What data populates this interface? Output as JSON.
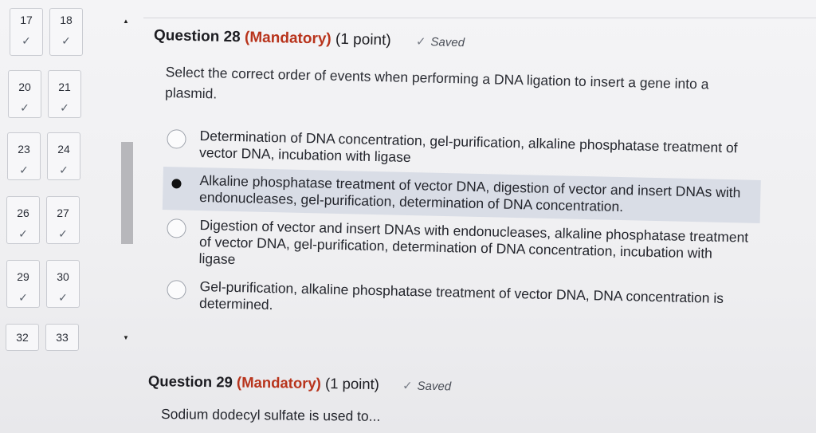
{
  "nav": {
    "cells": [
      {
        "num": "17",
        "check": "✓"
      },
      {
        "num": "18",
        "check": "✓"
      },
      {
        "num": "20",
        "check": "✓"
      },
      {
        "num": "21",
        "check": "✓"
      },
      {
        "num": "23",
        "check": "✓"
      },
      {
        "num": "24",
        "check": "✓"
      },
      {
        "num": "26",
        "check": "✓"
      },
      {
        "num": "27",
        "check": "✓"
      },
      {
        "num": "29",
        "check": "✓"
      },
      {
        "num": "30",
        "check": "✓"
      },
      {
        "num": "32",
        "check": ""
      },
      {
        "num": "33",
        "check": ""
      }
    ],
    "scroll_up_icon": "▲",
    "scroll_down_icon": "▼"
  },
  "question28": {
    "title": "Question 28",
    "mandatory": "(Mandatory)",
    "points": "(1 point)",
    "saved_icon": "✓",
    "saved": "Saved",
    "prompt": "Select the correct order of events when performing a DNA ligation to insert a gene into a plasmid.",
    "selected_index": 1,
    "options": [
      "Determination of DNA concentration, gel-purification, alkaline phosphatase treatment of vector DNA, incubation with ligase",
      "Alkaline phosphatase treatment of vector DNA, digestion of vector and insert DNAs with endonucleases, gel-purification, determination of DNA concentration.",
      "Digestion of vector and insert DNAs with endonucleases, alkaline phosphatase treatment of vector DNA, gel-purification, determination of DNA concentration, incubation with ligase",
      "Gel-purification, alkaline phosphatase treatment of vector DNA, DNA concentration is determined."
    ]
  },
  "question29": {
    "title": "Question 29",
    "mandatory": "(Mandatory)",
    "points": "(1 point)",
    "saved_icon": "✓",
    "saved": "Saved",
    "prompt": "Sodium dodecyl sulfate is used to..."
  }
}
